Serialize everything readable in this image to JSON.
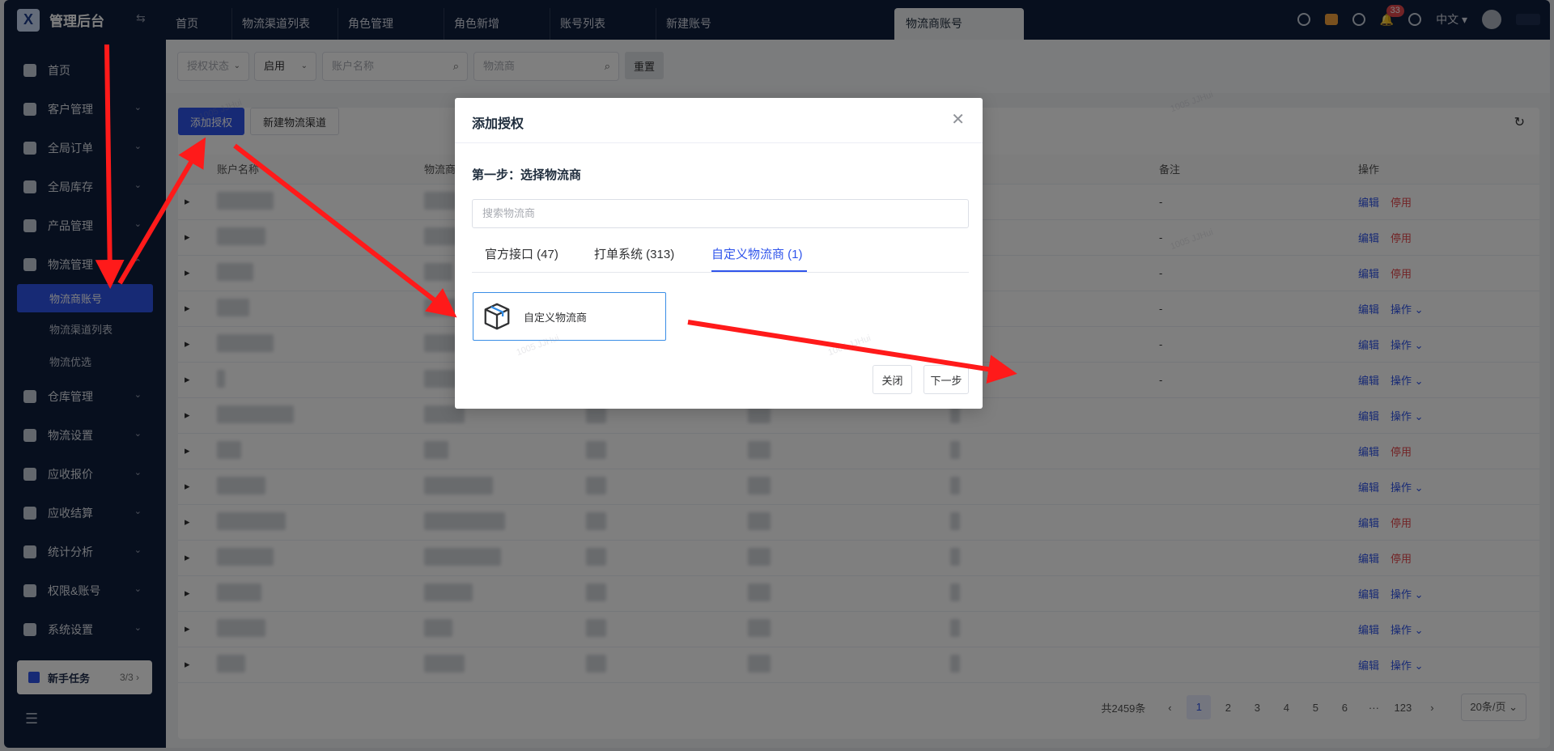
{
  "app": {
    "title": "管理后台",
    "logo_mark": "X"
  },
  "sidebar": {
    "items": [
      {
        "label": "首页",
        "icon": "home-icon",
        "has_children": false
      },
      {
        "label": "客户管理",
        "icon": "users-icon",
        "has_children": true
      },
      {
        "label": "全局订单",
        "icon": "order-icon",
        "has_children": true
      },
      {
        "label": "全局库存",
        "icon": "inventory-icon",
        "has_children": true
      },
      {
        "label": "产品管理",
        "icon": "product-icon",
        "has_children": true
      },
      {
        "label": "物流管理",
        "icon": "truck-icon",
        "has_children": true,
        "expanded": true,
        "children": [
          {
            "label": "物流商账号",
            "active": true
          },
          {
            "label": "物流渠道列表",
            "active": false
          },
          {
            "label": "物流优选",
            "active": false
          }
        ]
      },
      {
        "label": "仓库管理",
        "icon": "warehouse-icon",
        "has_children": true
      },
      {
        "label": "物流设置",
        "icon": "shipping-settings-icon",
        "has_children": true
      },
      {
        "label": "应收报价",
        "icon": "quote-icon",
        "has_children": true
      },
      {
        "label": "应收结算",
        "icon": "settlement-icon",
        "has_children": true
      },
      {
        "label": "统计分析",
        "icon": "chart-icon",
        "has_children": true
      },
      {
        "label": "权限&账号",
        "icon": "permission-icon",
        "has_children": true
      },
      {
        "label": "系统设置",
        "icon": "settings-icon",
        "has_children": true
      }
    ],
    "newbie": {
      "label": "新手任务",
      "count": "3/3"
    }
  },
  "tabs": [
    {
      "label": "首页",
      "active": false
    },
    {
      "label": "物流渠道列表",
      "active": false
    },
    {
      "label": "角色管理",
      "active": false
    },
    {
      "label": "角色新增",
      "active": false
    },
    {
      "label": "账号列表",
      "active": false
    },
    {
      "label": "新建账号",
      "active": false
    },
    {
      "label": "物流商账号",
      "active": true
    }
  ],
  "topbar": {
    "language": "中文",
    "notification_count": "33"
  },
  "filters": {
    "auth_status_placeholder": "授权状态",
    "enable_value": "启用",
    "account_name_placeholder": "账户名称",
    "carrier_placeholder": "物流商",
    "reset_label": "重置"
  },
  "toolbar": {
    "add_auth_label": "添加授权",
    "new_channel_label": "新建物流渠道"
  },
  "table": {
    "columns": [
      "账户名称",
      "物流商",
      "备注",
      "操作"
    ],
    "rows": [
      {
        "remark": "-",
        "actions": [
          "编辑",
          "停用"
        ]
      },
      {
        "remark": "-",
        "actions": [
          "编辑",
          "停用"
        ]
      },
      {
        "remark": "-",
        "actions": [
          "编辑",
          "停用"
        ]
      },
      {
        "remark": "-",
        "actions": [
          "编辑",
          "操作"
        ]
      },
      {
        "remark": "-",
        "actions": [
          "编辑",
          "操作"
        ]
      },
      {
        "remark": "-",
        "actions": [
          "编辑",
          "操作"
        ]
      },
      {
        "remark": "",
        "actions": [
          "编辑",
          "操作"
        ]
      },
      {
        "remark": "",
        "actions": [
          "编辑",
          "停用"
        ]
      },
      {
        "remark": "",
        "actions": [
          "编辑",
          "操作"
        ]
      },
      {
        "remark": "",
        "actions": [
          "编辑",
          "停用"
        ]
      },
      {
        "remark": "",
        "actions": [
          "编辑",
          "停用"
        ]
      },
      {
        "remark": "",
        "actions": [
          "编辑",
          "操作"
        ]
      },
      {
        "remark": "",
        "actions": [
          "编辑",
          "操作"
        ]
      },
      {
        "remark": "",
        "actions": [
          "编辑",
          "操作"
        ]
      }
    ]
  },
  "pagination": {
    "total": "共2459条",
    "pages": [
      "1",
      "2",
      "3",
      "4",
      "5",
      "6",
      "···",
      "123"
    ],
    "current": "1",
    "page_size": "20条/页"
  },
  "dialog": {
    "title": "添加授权",
    "step": "第一步：选择物流商",
    "search_placeholder": "搜索物流商",
    "tabs": [
      {
        "label": "官方接口 (47)",
        "active": false
      },
      {
        "label": "打单系统 (313)",
        "active": false
      },
      {
        "label": "自定义物流商 (1)",
        "active": true
      }
    ],
    "carrier_card": {
      "label": "自定义物流商",
      "icon": "box-icon"
    },
    "close_label": "关闭",
    "next_label": "下一步"
  },
  "colors": {
    "sidebar_bg": "#0f1e3d",
    "accent": "#2f54eb",
    "danger": "#e5484d",
    "arrow": "#ff1a1a"
  }
}
